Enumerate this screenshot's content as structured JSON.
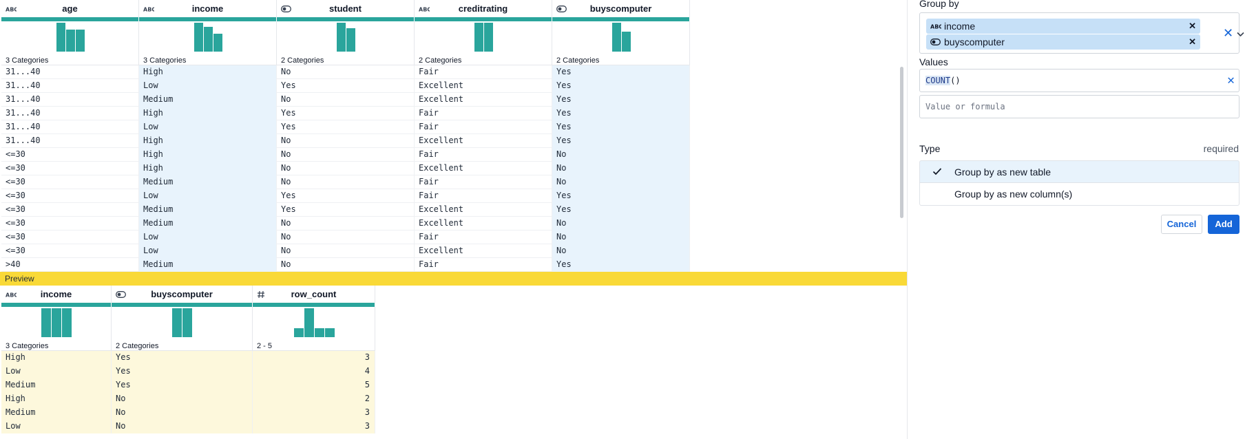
{
  "main_table": {
    "columns": [
      {
        "name": "age",
        "type_icon": "abc-text-icon",
        "summary": "3 Categories",
        "hist": [
          1.0,
          0.75,
          0.75
        ],
        "selected": false
      },
      {
        "name": "income",
        "type_icon": "abc-text-icon",
        "summary": "3 Categories",
        "hist": [
          1.0,
          0.85,
          0.62
        ],
        "selected": true
      },
      {
        "name": "student",
        "type_icon": "boolean-toggle-icon",
        "summary": "2 Categories",
        "hist": [
          1.0,
          0.8
        ],
        "selected": false
      },
      {
        "name": "creditrating",
        "type_icon": "abc-text-icon",
        "summary": "2 Categories",
        "hist": [
          1.0,
          1.0
        ],
        "selected": false
      },
      {
        "name": "buyscomputer",
        "type_icon": "boolean-toggle-icon",
        "summary": "2 Categories",
        "hist": [
          1.0,
          0.68
        ],
        "selected": true
      }
    ],
    "rows": [
      [
        "31...40",
        "High",
        "No",
        "Fair",
        "Yes"
      ],
      [
        "31...40",
        "Low",
        "Yes",
        "Excellent",
        "Yes"
      ],
      [
        "31...40",
        "Medium",
        "No",
        "Excellent",
        "Yes"
      ],
      [
        "31...40",
        "High",
        "Yes",
        "Fair",
        "Yes"
      ],
      [
        "31...40",
        "Low",
        "Yes",
        "Fair",
        "Yes"
      ],
      [
        "31...40",
        "High",
        "No",
        "Excellent",
        "Yes"
      ],
      [
        "<=30",
        "High",
        "No",
        "Fair",
        "No"
      ],
      [
        "<=30",
        "High",
        "No",
        "Excellent",
        "No"
      ],
      [
        "<=30",
        "Medium",
        "No",
        "Fair",
        "No"
      ],
      [
        "<=30",
        "Low",
        "Yes",
        "Fair",
        "Yes"
      ],
      [
        "<=30",
        "Medium",
        "Yes",
        "Excellent",
        "Yes"
      ],
      [
        "<=30",
        "Medium",
        "No",
        "Excellent",
        "No"
      ],
      [
        "<=30",
        "Low",
        "No",
        "Fair",
        "No"
      ],
      [
        "<=30",
        "Low",
        "No",
        "Excellent",
        "No"
      ],
      [
        ">40",
        "Medium",
        "No",
        "Fair",
        "Yes"
      ]
    ]
  },
  "preview": {
    "label": "Preview",
    "columns": [
      {
        "name": "income",
        "type_icon": "abc-text-icon",
        "summary": "3 Categories",
        "hist": [
          1.0,
          1.0,
          1.0
        ],
        "numeric": false
      },
      {
        "name": "buyscomputer",
        "type_icon": "boolean-toggle-icon",
        "summary": "2 Categories",
        "hist": [
          1.0,
          1.0
        ],
        "numeric": false
      },
      {
        "name": "row_count",
        "type_icon": "hash-number-icon",
        "summary": "2 - 5",
        "hist": [
          0.3,
          1.0,
          0.3,
          0.3
        ],
        "numeric": true
      }
    ],
    "rows": [
      [
        "High",
        "Yes",
        "3"
      ],
      [
        "Low",
        "Yes",
        "4"
      ],
      [
        "Medium",
        "Yes",
        "5"
      ],
      [
        "High",
        "No",
        "2"
      ],
      [
        "Medium",
        "No",
        "3"
      ],
      [
        "Low",
        "No",
        "3"
      ]
    ]
  },
  "panel": {
    "group_by_label": "Group by",
    "group_by_chips": [
      {
        "label": "income",
        "icon": "abc-text-icon"
      },
      {
        "label": "buyscomputer",
        "icon": "boolean-toggle-icon"
      }
    ],
    "values_label": "Values",
    "value_formula_fn": "COUNT",
    "value_formula_args": "()",
    "value_placeholder": "Value or formula",
    "type_label": "Type",
    "type_required": "required",
    "type_options": [
      "Group by as new table",
      "Group by as new column(s)"
    ],
    "type_selected": "Group by as new table",
    "cancel_label": "Cancel",
    "add_label": "Add"
  },
  "colors": {
    "accent": "#1565d8",
    "teal": "#2aa59c",
    "preview_yellow": "#f9d937",
    "selected_column": "#e8f3fc",
    "preview_cells": "#fdf8dc",
    "chip": "#c6e0f7"
  }
}
